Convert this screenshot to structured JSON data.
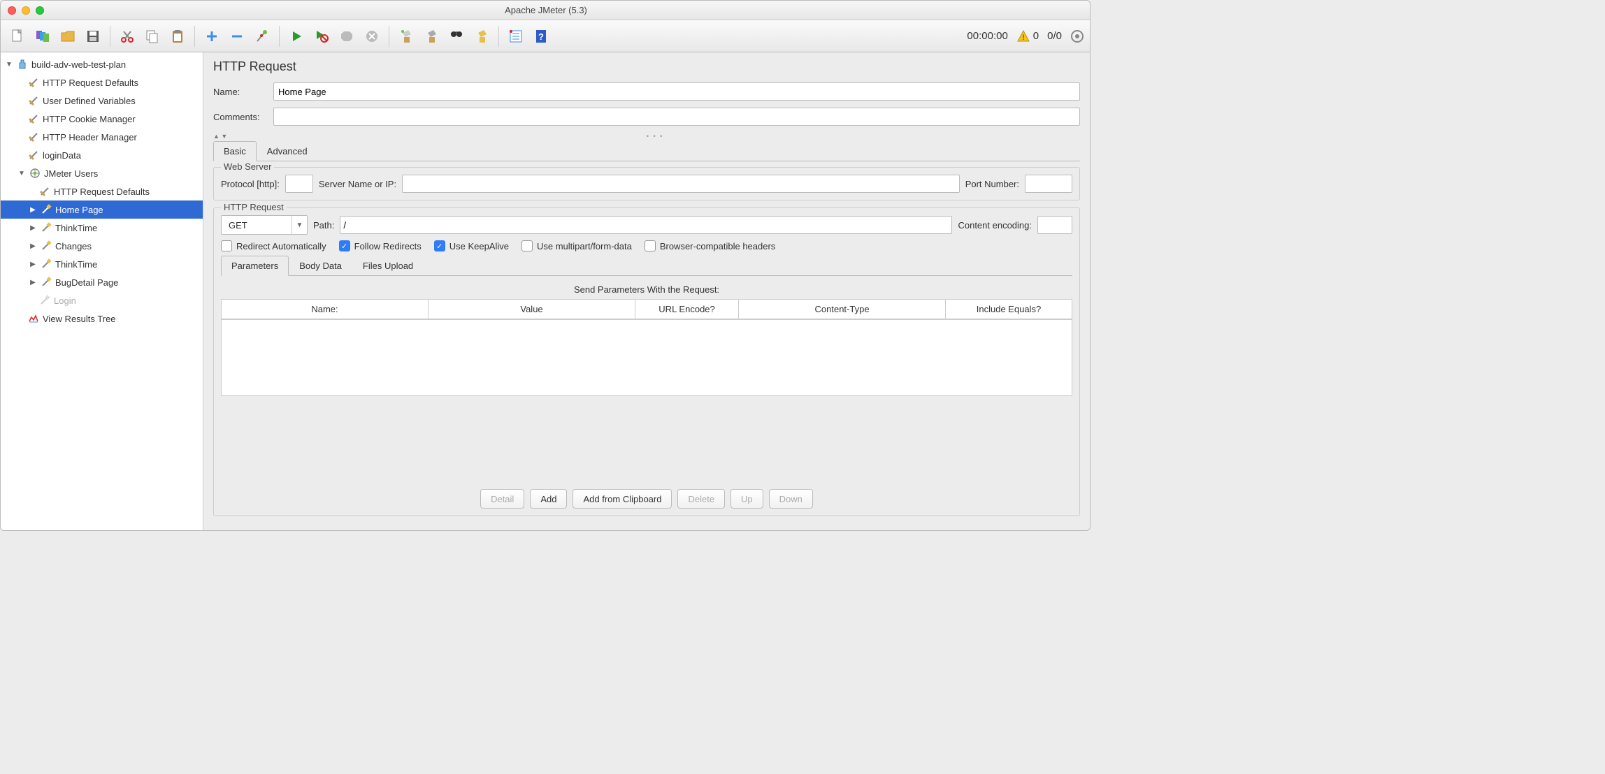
{
  "window": {
    "title": "Apache JMeter (5.3)"
  },
  "toolbar": {
    "timer": "00:00:00",
    "warn_count": "0",
    "thread_count": "0/0"
  },
  "tree": {
    "root": "build-adv-web-test-plan",
    "children": [
      "HTTP Request Defaults",
      "User Defined Variables",
      "HTTP Cookie Manager",
      "HTTP Header Manager",
      "loginData"
    ],
    "thread_group": "JMeter Users",
    "tg_children": [
      "HTTP Request Defaults",
      "Home Page",
      "ThinkTime",
      "Changes",
      "ThinkTime",
      "BugDetail Page",
      "Login"
    ],
    "tg_after": "View Results Tree"
  },
  "panel": {
    "title": "HTTP Request",
    "name_label": "Name:",
    "name_value": "Home Page",
    "comments_label": "Comments:",
    "comments_value": "",
    "tabs": {
      "basic": "Basic",
      "advanced": "Advanced"
    },
    "webserver": {
      "legend": "Web Server",
      "protocol_label": "Protocol [http]:",
      "protocol_value": "",
      "server_label": "Server Name or IP:",
      "server_value": "",
      "port_label": "Port Number:",
      "port_value": ""
    },
    "httpreq": {
      "legend": "HTTP Request",
      "method": "GET",
      "path_label": "Path:",
      "path_value": "/",
      "encoding_label": "Content encoding:",
      "encoding_value": "",
      "chk": {
        "redirect_auto": "Redirect Automatically",
        "follow_redirects": "Follow Redirects",
        "keepalive": "Use KeepAlive",
        "multipart": "Use multipart/form-data",
        "browser_headers": "Browser-compatible headers"
      }
    },
    "subtabs": {
      "params": "Parameters",
      "body": "Body Data",
      "files": "Files Upload"
    },
    "table": {
      "caption": "Send Parameters With the Request:",
      "cols": [
        "Name:",
        "Value",
        "URL Encode?",
        "Content-Type",
        "Include Equals?"
      ]
    },
    "buttons": {
      "detail": "Detail",
      "add": "Add",
      "clipboard": "Add from Clipboard",
      "delete": "Delete",
      "up": "Up",
      "down": "Down"
    }
  }
}
